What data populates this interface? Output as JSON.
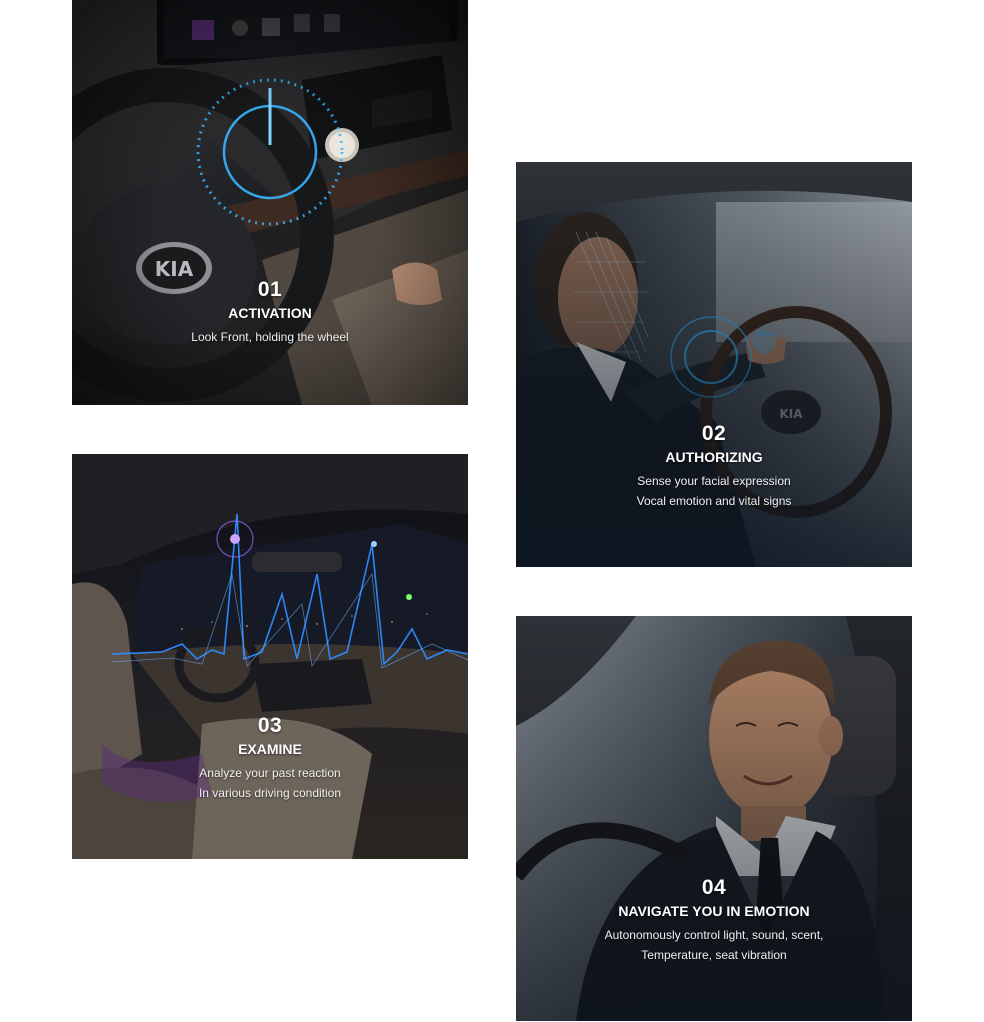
{
  "cards": [
    {
      "number": "01",
      "title": "ACTIVATION",
      "desc_line1": "Look Front, holding the wheel",
      "desc_line2": "",
      "scene": "steering-wheel-dashboard-photo"
    },
    {
      "number": "02",
      "title": "AUTHORIZING",
      "desc_line1": "Sense your facial expression",
      "desc_line2": "Vocal emotion and vital signs",
      "scene": "driver-face-scan-photo"
    },
    {
      "number": "03",
      "title": "EXAMINE",
      "desc_line1": "Analyze your past reaction",
      "desc_line2": "In various driving condition",
      "scene": "car-interior-pulse-graph-photo"
    },
    {
      "number": "04",
      "title": "NAVIGATE YOU IN EMOTION",
      "desc_line1": "Autonomously control light, sound, scent,",
      "desc_line2": "Temperature, seat vibration",
      "scene": "smiling-driver-photo"
    }
  ],
  "colors": {
    "background": "#ffffff",
    "text": "#ffffff",
    "accent_glow": "#35b6ff",
    "pulse_line": "#2f8cff"
  }
}
